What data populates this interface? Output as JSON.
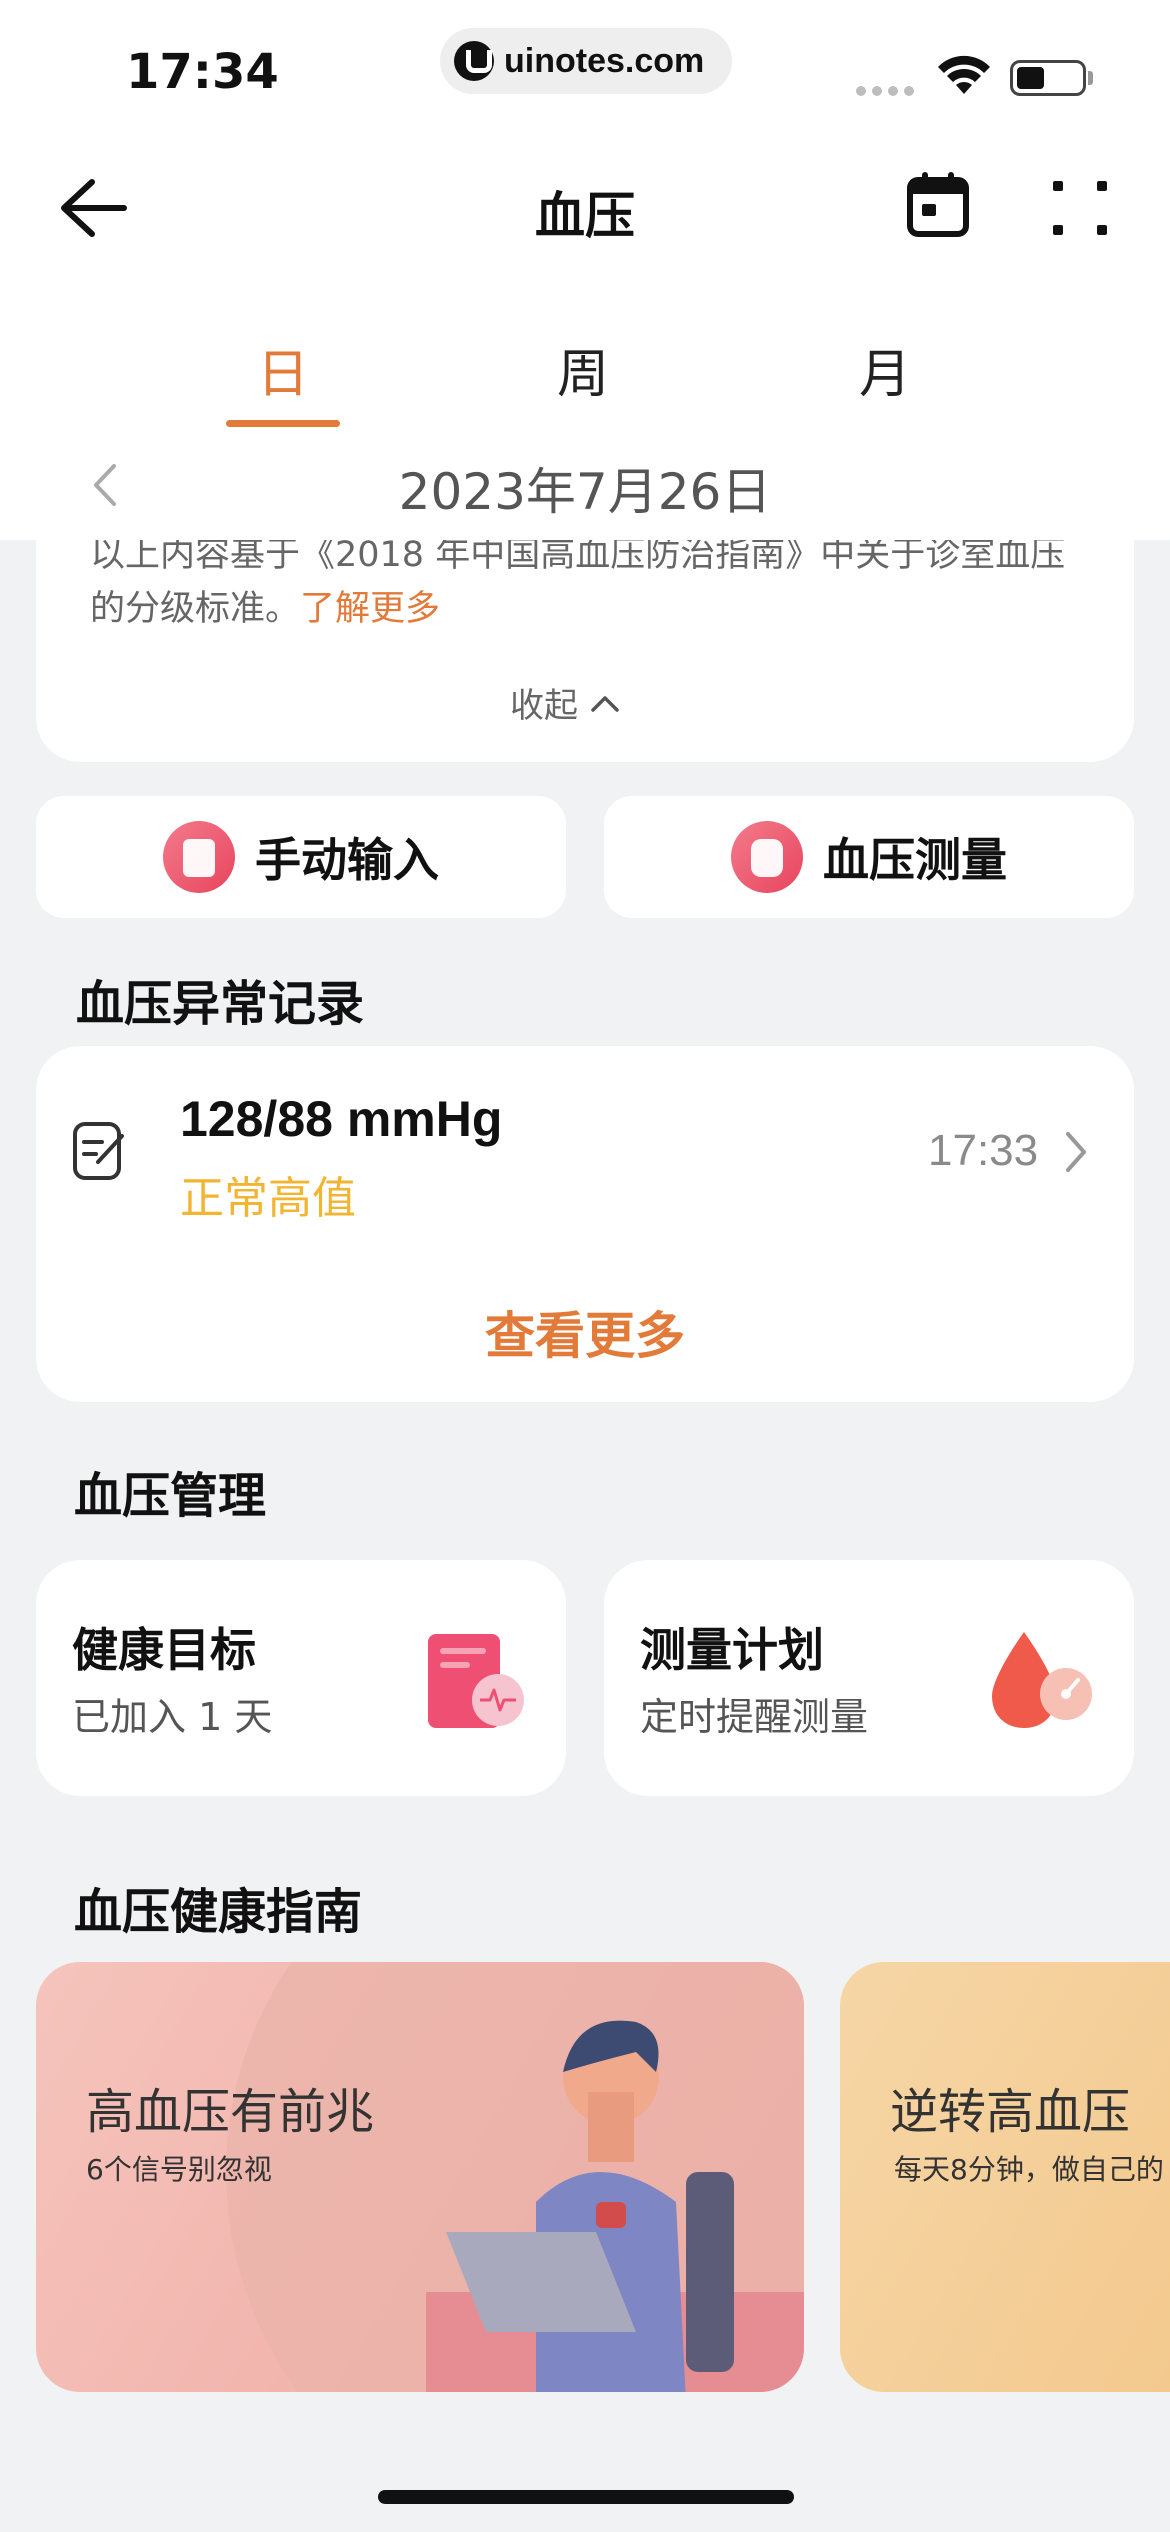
{
  "status_bar": {
    "time": "17:34",
    "url": "uinotes.com"
  },
  "header": {
    "title": "血压",
    "back_icon": "arrow-left-icon",
    "calendar_icon": "calendar-icon",
    "more_icon": "grid-more-icon"
  },
  "tabs": [
    {
      "label": "日",
      "active": true
    },
    {
      "label": "周",
      "active": false
    },
    {
      "label": "月",
      "active": false
    }
  ],
  "date_nav": {
    "date": "2023年7月26日"
  },
  "info": {
    "text": "以上内容基于《2018 年中国高血压防治指南》中关于诊室血压的分级标准。",
    "link": "了解更多",
    "collapse": "收起"
  },
  "actions": [
    {
      "label": "手动输入",
      "icon": "edit-icon"
    },
    {
      "label": "血压测量",
      "icon": "device-icon"
    }
  ],
  "abnormal": {
    "title": "血压异常记录",
    "record": {
      "value": "128/88 mmHg",
      "status": "正常高值",
      "time": "17:33"
    },
    "see_more": "查看更多"
  },
  "management": {
    "title": "血压管理",
    "cards": [
      {
        "title": "健康目标",
        "sub": "已加入 1 天",
        "icon": "health-report-icon"
      },
      {
        "title": "测量计划",
        "sub": "定时提醒测量",
        "icon": "blood-drop-icon"
      }
    ]
  },
  "guide": {
    "title": "血压健康指南",
    "cards": [
      {
        "title": "高血压有前兆",
        "sub": "6个信号别忽视"
      },
      {
        "title": "逆转高血压",
        "sub": "每天8分钟，做自己的"
      }
    ]
  },
  "colors": {
    "accent": "#e27a3a",
    "warning": "#f2b532",
    "background": "#f1f2f4"
  }
}
